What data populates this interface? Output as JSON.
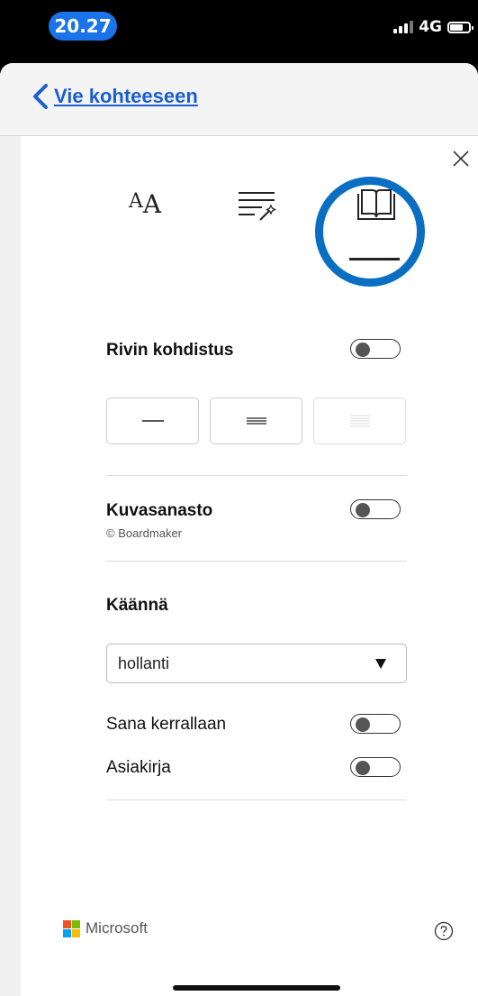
{
  "status": {
    "time": "20.27",
    "network": "4G"
  },
  "nav": {
    "back_label": "Vie kohteeseen"
  },
  "tabs": [
    {
      "name": "text-preferences",
      "icon": "text-size-icon"
    },
    {
      "name": "grammar-options",
      "icon": "grammar-magic-icon"
    },
    {
      "name": "reading-preferences",
      "icon": "book-icon",
      "selected": true
    }
  ],
  "reading": {
    "line_focus_label": "Rivin kohdistus",
    "line_focus_on": false,
    "picture_dictionary_label": "Kuvasanasto",
    "picture_dictionary_credit": "© Boardmaker",
    "picture_dictionary_on": false,
    "translate_heading": "Käännä",
    "language_value": "hollanti",
    "word_by_word_label": "Sana kerrallaan",
    "word_by_word_on": false,
    "document_label": "Asiakirja",
    "document_on": false
  },
  "footer": {
    "brand": "Microsoft"
  },
  "colors": {
    "accent": "#1a5fd0",
    "ring": "#0a6fc2"
  }
}
